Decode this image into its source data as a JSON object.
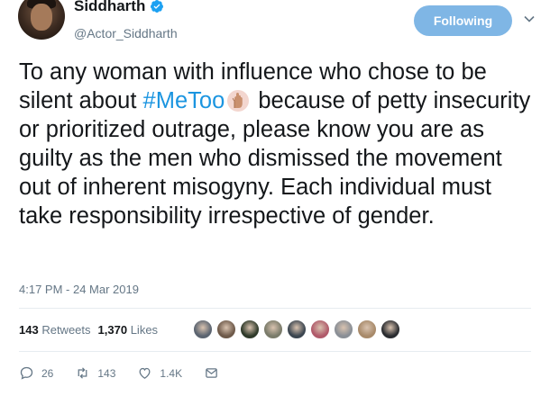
{
  "author": {
    "display_name": "Siddharth",
    "handle": "@Actor_Siddharth",
    "verified_icon": "verified-badge-icon"
  },
  "follow_button": {
    "label": "Following",
    "color": "#7fb6e5"
  },
  "tweet": {
    "text_before": "To any woman with influence who chose to be silent about",
    "hashtag": "#MeToo",
    "text_after": "because of petty insecurity or prioritized outrage, please know you are as guilty as the men who dismissed the movement out of inherent misogyny. Each individual must take responsibility irrespective of gender.",
    "hashtag_color": "#1b95e0",
    "emoji": "raised-hand-emoji"
  },
  "timestamp": "4:17 PM - 24 Mar 2019",
  "stats": {
    "retweets_count": "143",
    "retweets_label": "Retweets",
    "likes_count": "1,370",
    "likes_label": "Likes"
  },
  "likers": [
    {
      "color": "#5b6470"
    },
    {
      "color": "#6e5a4a"
    },
    {
      "color": "#2f3a2a"
    },
    {
      "color": "#7a7b6a"
    },
    {
      "color": "#3c4650"
    },
    {
      "color": "#b05a6a"
    },
    {
      "color": "#8a8f96"
    },
    {
      "color": "#a88a6a"
    },
    {
      "color": "#2a2c30"
    }
  ],
  "actions": {
    "reply_count": "26",
    "retweet_count": "143",
    "like_count": "1.4K",
    "icons": [
      "reply-icon",
      "retweet-icon",
      "heart-icon",
      "message-icon"
    ]
  }
}
